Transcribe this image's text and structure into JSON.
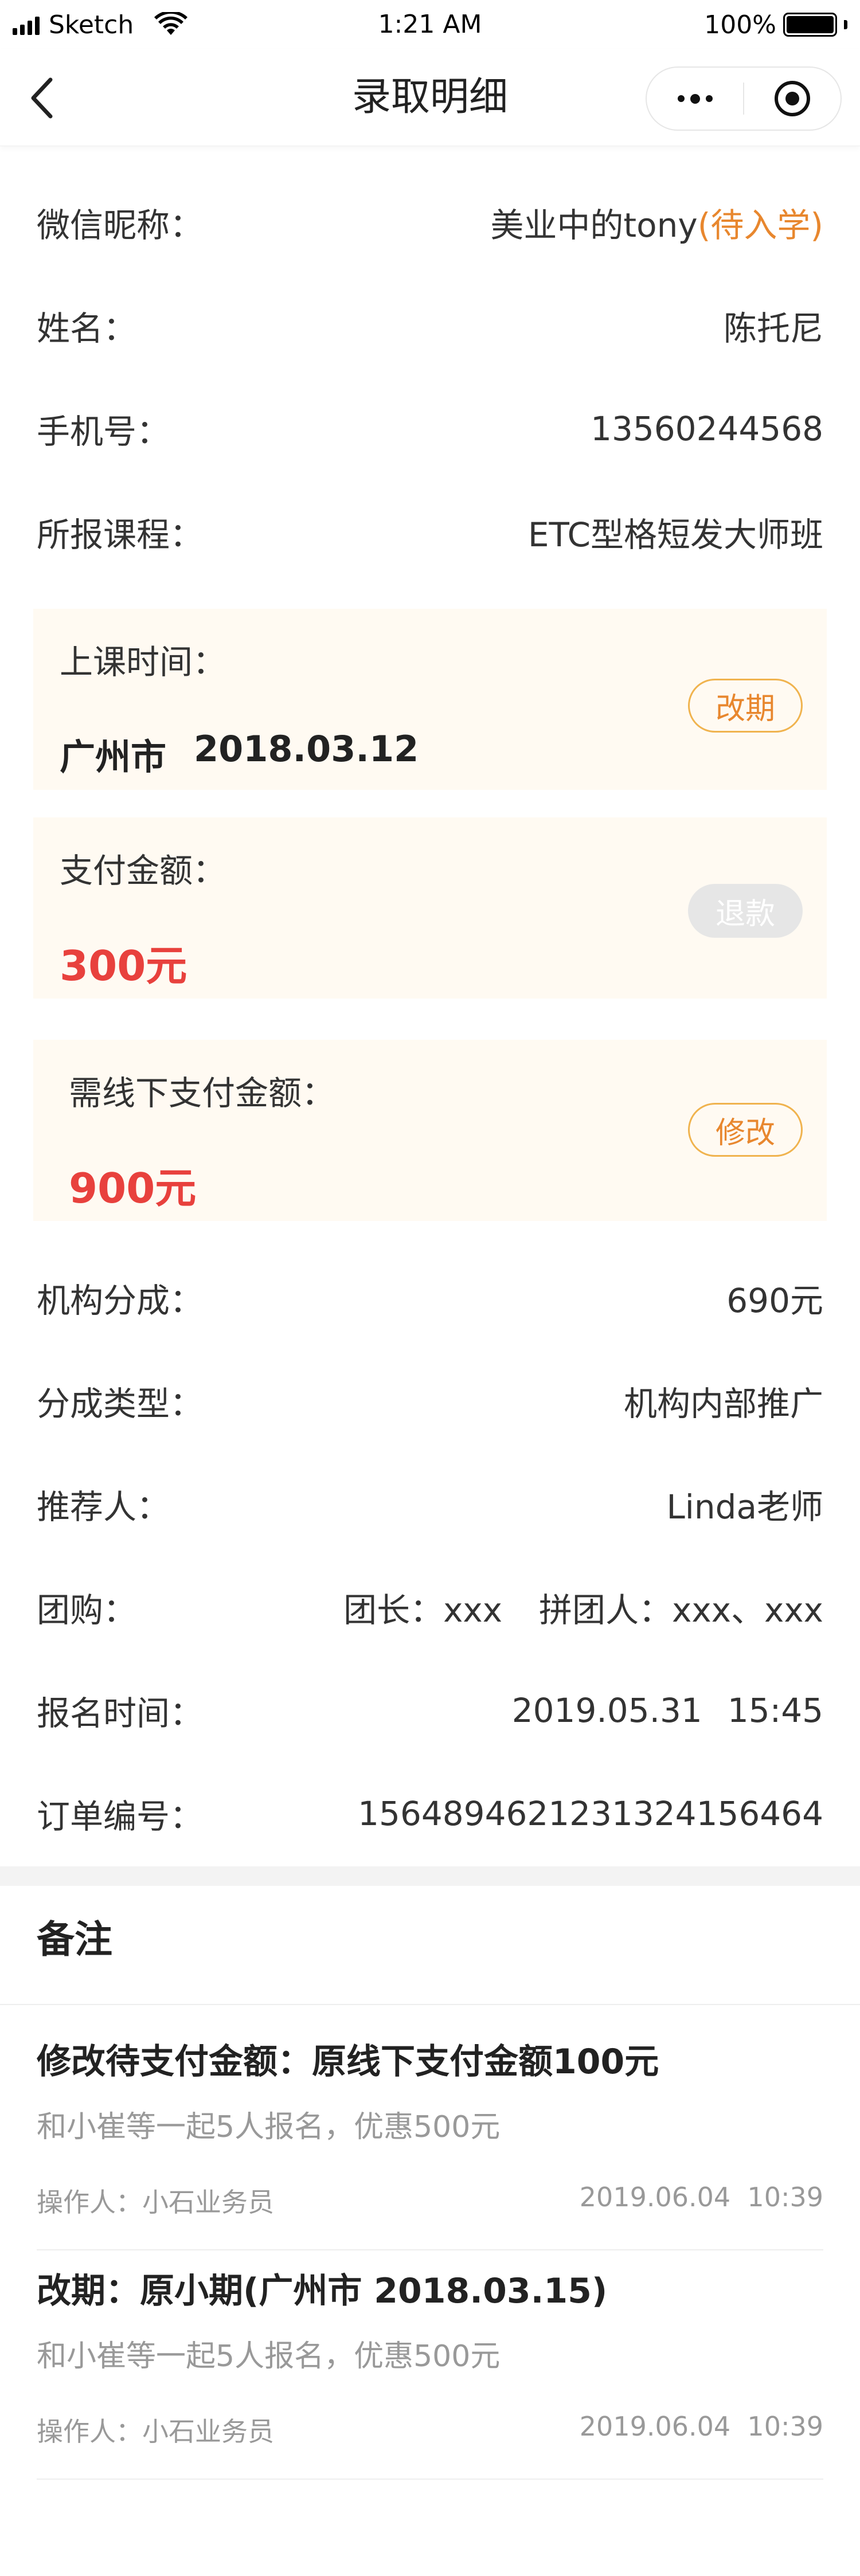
{
  "status_bar": {
    "carrier": "Sketch",
    "time": "1:21 AM",
    "battery_text": "100%",
    "battery_level": 1.0
  },
  "nav": {
    "title": "录取明细"
  },
  "fields": {
    "wechat_nickname": {
      "label": "微信昵称：",
      "value": "美业中的tony",
      "status": "(待入学)"
    },
    "name": {
      "label": "姓名：",
      "value": "陈托尼"
    },
    "phone": {
      "label": "手机号：",
      "value": "13560244568"
    },
    "course": {
      "label": "所报课程：",
      "value": "ETC型格短发大师班"
    }
  },
  "class_time_card": {
    "label": "上课时间：",
    "city": "广州市",
    "date": "2018.03.12",
    "button": "改期"
  },
  "payment_card": {
    "label": "支付金额：",
    "amount": "300元",
    "button": "退款"
  },
  "offline_card": {
    "label": "需线下支付金额：",
    "amount": "900元",
    "button": "修改"
  },
  "details": {
    "institution_share": {
      "label": "机构分成：",
      "value": "690元"
    },
    "share_type": {
      "label": "分成类型：",
      "value": "机构内部推广"
    },
    "referrer": {
      "label": "推荐人：",
      "value": "Linda老师"
    },
    "group_buy": {
      "label": "团购：",
      "leader": "团长：xxx",
      "members": "拼团人：xxx、xxx"
    },
    "signup_time": {
      "label": "报名时间：",
      "date": "2019.05.31",
      "time": "15:45"
    },
    "order_no": {
      "label": "订单编号：",
      "value": "1564894621231324156464"
    }
  },
  "remarks": {
    "title": "备注",
    "items": [
      {
        "title": "修改待支付金额：原线下支付金额100元",
        "desc": "和小崔等一起5人报名，优惠500元",
        "operator": "操作人：小石业务员",
        "date": "2019.06.04",
        "time": "10:39"
      },
      {
        "title": "改期：原小期(广州市 2018.03.15)",
        "desc": "和小崔等一起5人报名，优惠500元",
        "operator": "操作人：小石业务员",
        "date": "2019.06.04",
        "time": "10:39"
      }
    ]
  },
  "colors": {
    "accent_orange": "#e8872e",
    "price_red": "#e8413d",
    "card_bg": "#fffaf2"
  }
}
